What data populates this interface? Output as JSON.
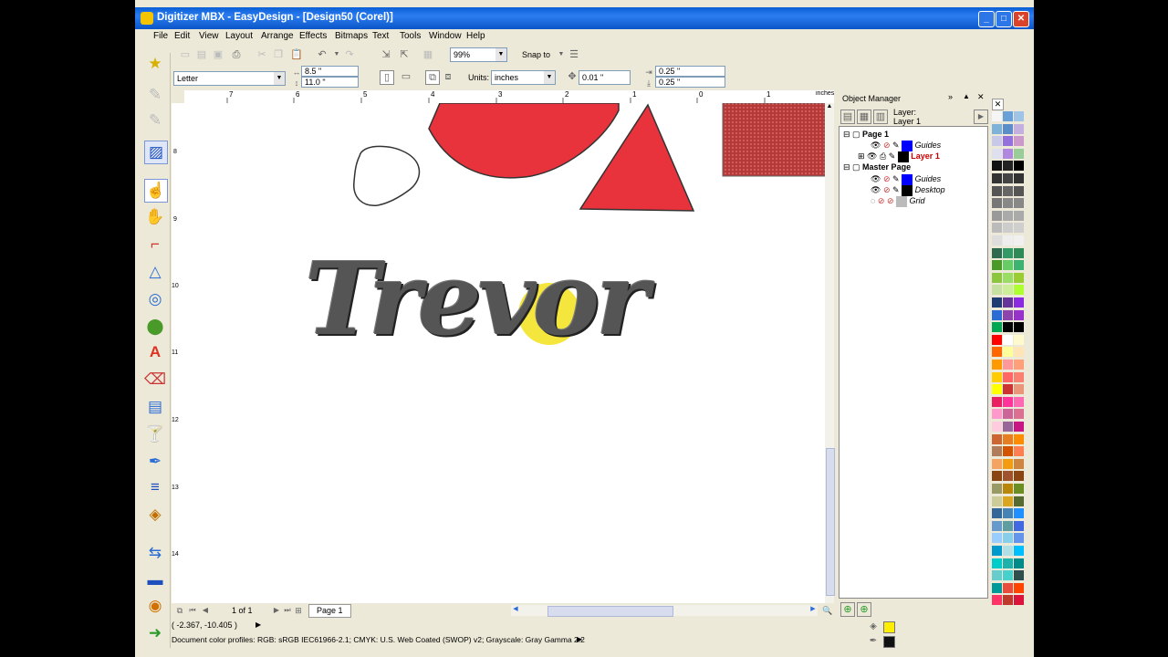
{
  "window": {
    "title": "Digitizer MBX - EasyDesign - [Design50 (Corel)]"
  },
  "menu": [
    "File",
    "Edit",
    "View",
    "Layout",
    "Arrange",
    "Effects",
    "Bitmaps",
    "Text",
    "Tools",
    "Window",
    "Help"
  ],
  "toolbar": {
    "zoom": "99%",
    "snap_to": "Snap to"
  },
  "property_bar": {
    "page_size": "Letter",
    "width": "8.5 \"",
    "height": "11.0 \"",
    "units_label": "Units:",
    "units": "inches",
    "nudge": "0.01 \"",
    "dup_x": "0.25 \"",
    "dup_y": "0.25 \""
  },
  "ruler": {
    "unit": "inches",
    "h_ticks": [
      "7",
      "6",
      "5",
      "4",
      "3",
      "2",
      "1",
      "0",
      "1"
    ],
    "v_ticks": [
      "8",
      "9",
      "10",
      "11",
      "12",
      "13",
      "14"
    ]
  },
  "canvas": {
    "embroidery_text": "Trevor"
  },
  "page_nav": {
    "counter": "1 of 1",
    "tab": "Page 1"
  },
  "status": {
    "coords": "( -2.367, -10.405 )",
    "profiles": "Document color profiles: RGB: sRGB IEC61966-2.1; CMYK: U.S. Web Coated (SWOP) v2; Grayscale: Gray Gamma 2.2"
  },
  "object_manager": {
    "title": "Object Manager",
    "layer_label": "Layer:",
    "layer_value": "Layer 1",
    "tree": {
      "page1": "Page 1",
      "page1_guides": "Guides",
      "page1_layer": "Layer 1",
      "master": "Master Page",
      "master_guides": "Guides",
      "master_desktop": "Desktop",
      "master_grid": "Grid"
    }
  },
  "colors": {
    "accent_red": "#e8333c",
    "layer_red": "#cc0000",
    "title_blue": "#0a5fd6"
  }
}
